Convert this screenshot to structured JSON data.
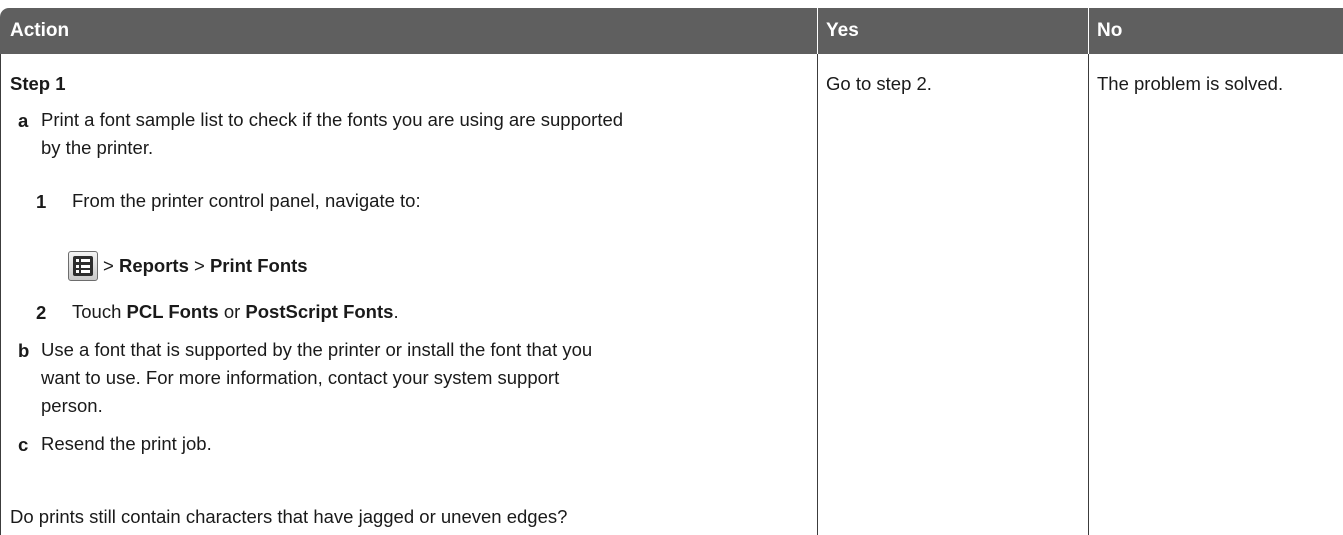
{
  "header": {
    "action": "Action",
    "yes": "Yes",
    "no": "No"
  },
  "row": {
    "step_title": "Step 1",
    "a_letter": "a",
    "a_line1": "Print a font sample list to check if the fonts you are using are supported",
    "a_line2": "by the printer.",
    "sub1_num": "1",
    "sub1_text": "From the printer control panel, navigate to:",
    "nav_sep1": " > ",
    "nav_reports": "Reports",
    "nav_sep2": " > ",
    "nav_print_fonts": "Print Fonts",
    "sub2_num": "2",
    "sub2_touch": "Touch ",
    "sub2_pcl": "PCL Fonts",
    "sub2_or": " or ",
    "sub2_ps": "PostScript Fonts",
    "sub2_end": ".",
    "b_letter": "b",
    "b_line1": "Use a font that is supported by the printer or install the font that you",
    "b_line2": "want to use. For more information, contact your system support",
    "b_line3": "person.",
    "c_letter": "c",
    "c_text": "Resend the print job.",
    "question": "Do prints still contain characters that have jagged or uneven edges?",
    "yes": "Go to step 2.",
    "no": "The problem is solved."
  },
  "icons": {
    "menu": "menu-list-icon"
  },
  "colors": {
    "header_bg": "#5f5f5f",
    "header_text": "#ffffff"
  }
}
